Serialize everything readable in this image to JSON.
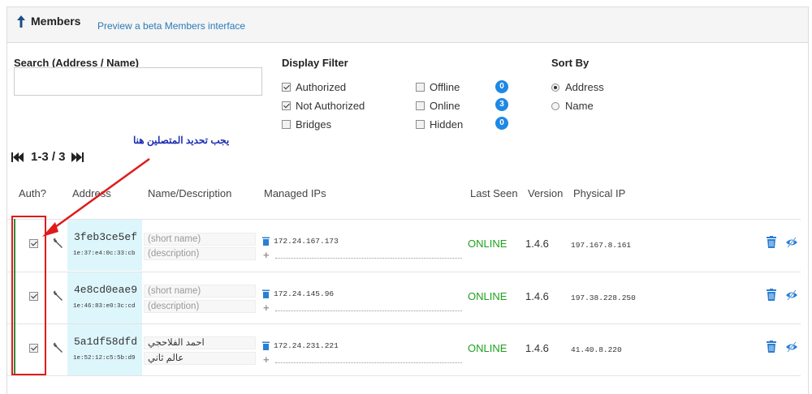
{
  "header": {
    "title": "Members",
    "beta_link": "Preview a beta Members interface"
  },
  "search": {
    "label": "Search (Address / Name)",
    "value": "",
    "placeholder": ""
  },
  "display_filter": {
    "label": "Display Filter",
    "options": [
      {
        "label": "Authorized",
        "checked": true
      },
      {
        "label": "Not Authorized",
        "checked": true
      },
      {
        "label": "Bridges",
        "checked": false
      },
      {
        "label": "Offline",
        "checked": false,
        "count": "0"
      },
      {
        "label": "Online",
        "checked": false,
        "count": "3"
      },
      {
        "label": "Hidden",
        "checked": false,
        "count": "0"
      }
    ]
  },
  "sort_by": {
    "label": "Sort By",
    "options": [
      {
        "label": "Address",
        "selected": true
      },
      {
        "label": "Name",
        "selected": false
      }
    ]
  },
  "pager": {
    "text": "1-3 / 3"
  },
  "annotation": {
    "text": "يجب تحديد المتصلين هنا"
  },
  "columns": [
    "Auth?",
    "Address",
    "Name/Description",
    "Managed IPs",
    "Last Seen",
    "Version",
    "Physical IP"
  ],
  "members": [
    {
      "authorized": true,
      "address": "3feb3ce5ef",
      "mac": "1e:37:e4:0c:33:cb",
      "short_name": "(short name)",
      "description": "(description)",
      "name_filled": false,
      "managed_ip": "172.24.167.173",
      "last_seen": "ONLINE",
      "version": "1.4.6",
      "physical_ip": "197.167.8.161"
    },
    {
      "authorized": true,
      "address": "4e8cd0eae9",
      "mac": "1e:46:83:e0:3c:cd",
      "short_name": "(short name)",
      "description": "(description)",
      "name_filled": false,
      "managed_ip": "172.24.145.96",
      "last_seen": "ONLINE",
      "version": "1.4.6",
      "physical_ip": "197.38.228.250"
    },
    {
      "authorized": true,
      "address": "5a1df58dfd",
      "mac": "1e:52:12:c5:5b:d9",
      "short_name": "احمد الفلاحجي",
      "description": "عالم ثاني",
      "name_filled": true,
      "managed_ip": "172.24.231.221",
      "last_seen": "ONLINE",
      "version": "1.4.6",
      "physical_ip": "41.40.8.220"
    }
  ],
  "colors": {
    "accent": "#1e88e5",
    "link": "#2a7ab8",
    "online": "#1ea01e",
    "address_bg": "#ddf6fb",
    "annotation_red": "#e01b1b",
    "annotation_text": "#1a2db0"
  }
}
